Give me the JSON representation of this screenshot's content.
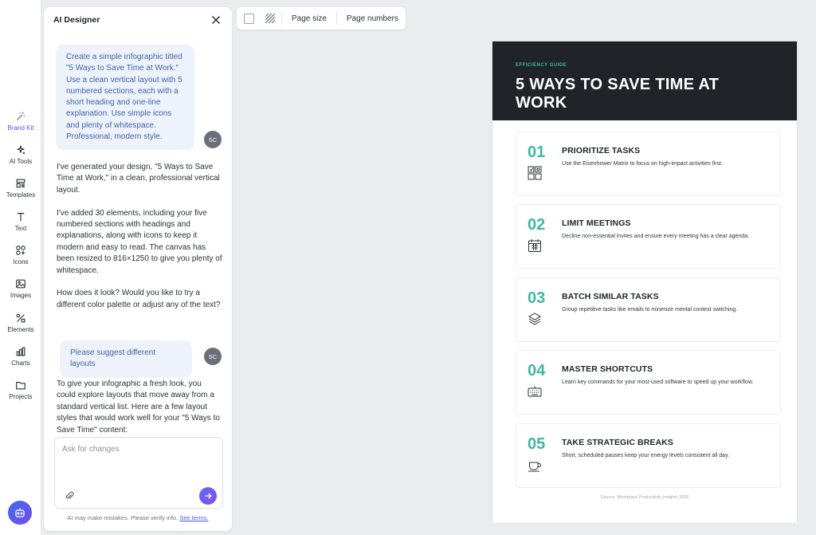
{
  "sidebar": {
    "items": [
      {
        "label": "Brand Kit",
        "icon": "magic-wand-icon"
      },
      {
        "label": "AI Tools",
        "icon": "sparkles-icon"
      },
      {
        "label": "Templates",
        "icon": "templates-icon"
      },
      {
        "label": "Text",
        "icon": "text-icon"
      },
      {
        "label": "Icons",
        "icon": "shapes-icon"
      },
      {
        "label": "Images",
        "icon": "image-icon"
      },
      {
        "label": "Elements",
        "icon": "elements-icon"
      },
      {
        "label": "Charts",
        "icon": "bar-chart-icon"
      },
      {
        "label": "Projects",
        "icon": "folder-icon"
      }
    ]
  },
  "panel": {
    "title": "AI Designer",
    "messages": {
      "user1": "Create a simple infographic titled \"5 Ways to Save Time at Work.\" Use a clean vertical layout with 5 numbered sections, each with a short heading and one-line explanation. Use simple icons and plenty of whitespace. Professional, modern style.",
      "avatar1": "SC",
      "ai1_p1": "I've generated your design, \"5 Ways to Save Time at Work,\" in a clean, professional vertical layout.",
      "ai1_p2": "I've added 30 elements, including your five numbered sections with headings and explanations, along with icons to keep it modern and easy to read. The canvas has been resized to 816×1250 to give you plenty of whitespace.",
      "ai1_p3": "How does it look? Would you like to try a different color palette or adjust any of the text?",
      "user2": "Please suggest different layouts",
      "avatar2": "SC",
      "ai2_p1": "To give your infographic a fresh look, you could explore layouts that move away from a standard vertical list. Here are a few layout styles that would work well for your \"5 Ways to Save Time\" content:"
    },
    "input_placeholder": "Ask for changes",
    "input_value": "",
    "disclaimer": "AI may make mistakes. Please verify info.",
    "terms_link": "See terms."
  },
  "toolbar": {
    "page_size": "Page size",
    "page_numbers": "Page numbers"
  },
  "doc": {
    "eyebrow": "EFFICIENCY GUIDE",
    "title": "5 WAYS TO SAVE TIME AT WORK",
    "accent": "#3fb8a0",
    "header_bg": "#202327",
    "items": [
      {
        "num": "01",
        "heading": "PRIORITIZE TASKS",
        "text": "Use the Eisenhower Matrix to focus on high-impact activities first.",
        "icon": "matrix-icon"
      },
      {
        "num": "02",
        "heading": "LIMIT MEETINGS",
        "text": "Decline non-essential invites and ensure every meeting has a clear agenda.",
        "icon": "calendar-icon"
      },
      {
        "num": "03",
        "heading": "BATCH SIMILAR TASKS",
        "text": "Group repetitive tasks like emails to minimize mental context switching.",
        "icon": "layers-icon"
      },
      {
        "num": "04",
        "heading": "MASTER SHORTCUTS",
        "text": "Learn key commands for your most-used software to speed up your workflow.",
        "icon": "keyboard-icon"
      },
      {
        "num": "05",
        "heading": "TAKE STRATEGIC BREAKS",
        "text": "Short, scheduled pauses keep your energy levels consistent all day.",
        "icon": "coffee-cup-icon"
      }
    ],
    "source": "Source: Workplace Productivity Insights 2026"
  }
}
